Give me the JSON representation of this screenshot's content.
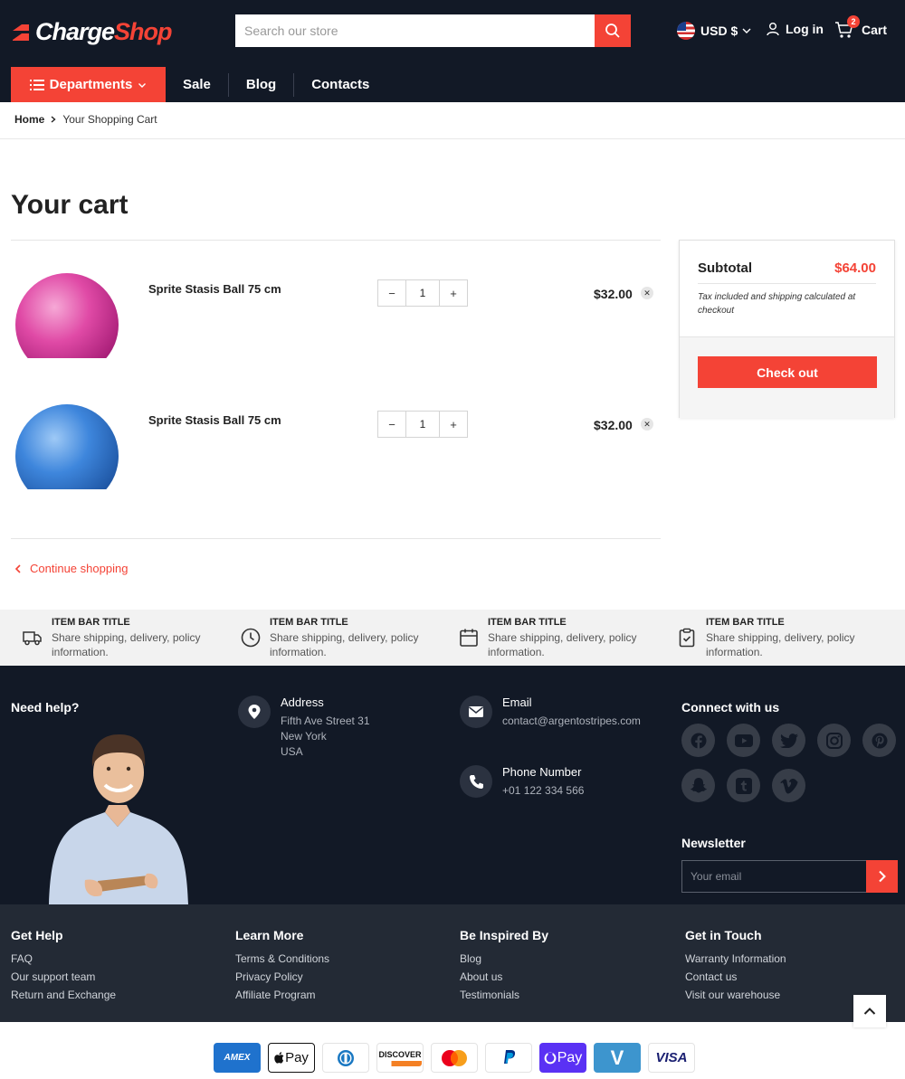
{
  "brand": {
    "name_part1": "Charge",
    "name_part2": "Shop",
    "accent": "#f44336",
    "dark": "#121926"
  },
  "search": {
    "placeholder": "Search our store",
    "icon": "search-icon"
  },
  "header": {
    "currency": "USD $",
    "login": "Log in",
    "cart": "Cart",
    "cart_count": "2"
  },
  "nav": {
    "departments": "Departments",
    "links": [
      "Sale",
      "Blog",
      "Contacts"
    ]
  },
  "breadcrumb": {
    "home": "Home",
    "current": "Your Shopping Cart"
  },
  "page": {
    "title": "Your cart"
  },
  "cart_items": [
    {
      "name": "Sprite Stasis Ball 75 cm",
      "qty": "1",
      "price": "$32.00",
      "color": "pink"
    },
    {
      "name": "Sprite Stasis Ball 75 cm",
      "qty": "1",
      "price": "$32.00",
      "color": "blue"
    }
  ],
  "continue_shopping": "Continue shopping",
  "summary": {
    "subtotal_label": "Subtotal",
    "subtotal_value": "$64.00",
    "note": "Tax included and shipping calculated at checkout",
    "checkout": "Check out"
  },
  "item_bar": [
    {
      "title": "ITEM BAR TITLE",
      "desc": "Share shipping, delivery, policy information.",
      "icon": "truck-icon"
    },
    {
      "title": "ITEM BAR TITLE",
      "desc": "Share shipping, delivery, policy information.",
      "icon": "clock-icon"
    },
    {
      "title": "ITEM BAR TITLE",
      "desc": "Share shipping, delivery, policy information.",
      "icon": "calendar-icon"
    },
    {
      "title": "ITEM BAR TITLE",
      "desc": "Share shipping, delivery, policy information.",
      "icon": "clipboard-icon"
    }
  ],
  "footer": {
    "need_help": "Need help?",
    "address_title": "Address",
    "address_lines": [
      "Fifth Ave Street 31",
      "New York",
      "USA"
    ],
    "email_title": "Email",
    "email": "contact@argentostripes.com",
    "phone_title": "Phone Number",
    "phone": "+01 122 334 566",
    "connect": "Connect with us",
    "socials": [
      "facebook-icon",
      "youtube-icon",
      "twitter-icon",
      "instagram-icon",
      "pinterest-icon",
      "snapchat-icon",
      "tumblr-icon",
      "vimeo-icon"
    ],
    "newsletter": "Newsletter",
    "newsletter_placeholder": "Your email"
  },
  "footer_links": [
    {
      "title": "Get Help",
      "links": [
        "FAQ",
        "Our support team",
        "Return and Exchange"
      ]
    },
    {
      "title": "Learn More",
      "links": [
        "Terms & Conditions",
        "Privacy Policy",
        "Affiliate Program"
      ]
    },
    {
      "title": "Be Inspired By",
      "links": [
        "Blog",
        "About us",
        "Testimonials"
      ]
    },
    {
      "title": "Get in Touch",
      "links": [
        "Warranty Information",
        "Contact us",
        "Visit our warehouse"
      ]
    }
  ],
  "payments": [
    "AMEX",
    "Pay",
    "DISCOVER",
    "Pay",
    "V",
    "VISA"
  ]
}
